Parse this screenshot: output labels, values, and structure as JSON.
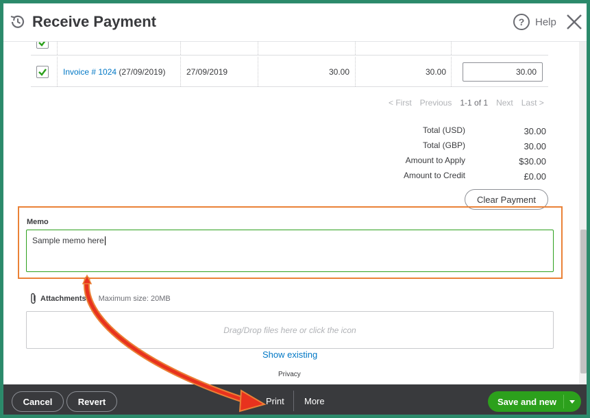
{
  "header": {
    "title": "Receive Payment",
    "help_symbol": "?",
    "help_label": "Help"
  },
  "table": {
    "rows": [
      {
        "checked": true,
        "invoice_link": "Invoice # 1024",
        "invoice_date_suffix": "(27/09/2019)",
        "due_date": "27/09/2019",
        "original_amount": "30.00",
        "open_balance": "30.00",
        "payment": "30.00"
      }
    ]
  },
  "pager": {
    "first": "< First",
    "previous": "Previous",
    "range": "1-1 of 1",
    "next": "Next",
    "last": "Last >"
  },
  "totals": [
    {
      "label": "Total (USD)",
      "value": "30.00"
    },
    {
      "label": "Total (GBP)",
      "value": "30.00"
    },
    {
      "label": "Amount to Apply",
      "value": "$30.00"
    },
    {
      "label": "Amount to Credit",
      "value": "£0.00"
    }
  ],
  "clear_payment_label": "Clear Payment",
  "memo": {
    "label": "Memo",
    "value": "Sample memo here"
  },
  "attachments": {
    "label": "Attachments",
    "max_size": "Maximum size: 20MB",
    "dropzone_text": "Drag/Drop files here or click the icon",
    "show_existing": "Show existing"
  },
  "privacy_label": "Privacy",
  "footer": {
    "cancel": "Cancel",
    "revert": "Revert",
    "print": "Print",
    "more": "More",
    "save_new": "Save and new"
  },
  "colors": {
    "accent_green": "#2ca01c",
    "link_blue": "#0077c5",
    "highlight_orange": "#ea8136",
    "footer_bg": "#393a3d",
    "arrow_red": "#e8321e"
  },
  "icons": [
    "history-icon",
    "help-icon",
    "close-icon",
    "checkbox-checked-icon",
    "paperclip-icon",
    "dropdown-caret-icon",
    "arrow-annotation"
  ]
}
